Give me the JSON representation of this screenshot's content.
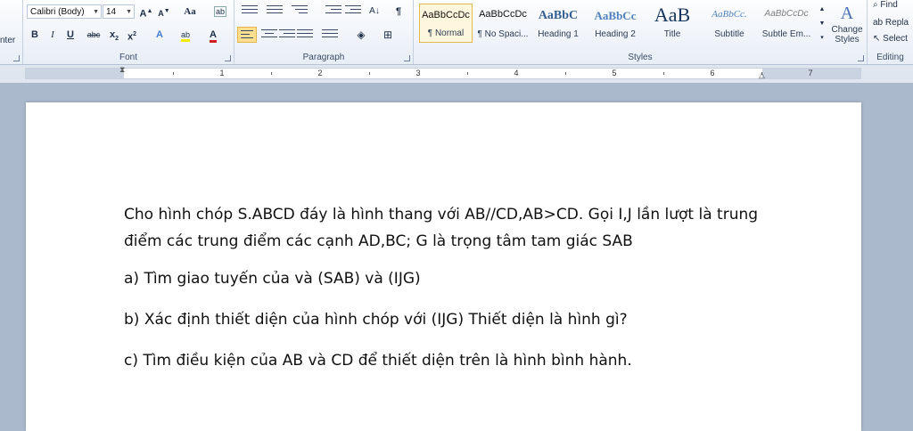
{
  "ribbon": {
    "clipboard_fragment": "nter",
    "font": {
      "group_label": "Font",
      "font_name": "Calibri (Body)",
      "font_size": "14",
      "grow_glyph": "A",
      "shrink_glyph": "A",
      "change_case": "Aa",
      "bold": "B",
      "italic": "I",
      "underline": "U",
      "strike": "abc",
      "subscript": "x",
      "superscript": "x",
      "font_color_glyph": "A",
      "text_effects_glyph": "A",
      "highlight_glyph": "ab"
    },
    "paragraph": {
      "group_label": "Paragraph",
      "pilcrow": "¶"
    },
    "styles": {
      "group_label": "Styles",
      "tiles": [
        {
          "sample": "AaBbCcDc",
          "name": "¶ Normal"
        },
        {
          "sample": "AaBbCcDc",
          "name": "¶ No Spaci..."
        },
        {
          "sample": "AaBbC",
          "name": "Heading 1"
        },
        {
          "sample": "AaBbCc",
          "name": "Heading 2"
        },
        {
          "sample": "AaB",
          "name": "Title"
        },
        {
          "sample": "AaBbCc.",
          "name": "Subtitle"
        },
        {
          "sample": "AaBbCcDc",
          "name": "Subtle Em..."
        }
      ],
      "change_styles_line1": "Change",
      "change_styles_line2": "Styles"
    },
    "editing": {
      "group_label": "Editing",
      "find": "Find",
      "replace": "Repla",
      "select": "Select"
    }
  },
  "ruler": {
    "numbers": [
      "1",
      "2",
      "3",
      "4",
      "5",
      "6",
      "7"
    ]
  },
  "document": {
    "paragraphs": [
      "Cho hình chóp S.ABCD đáy là hình thang với AB//CD,AB>CD.  Gọi I,J lần lượt là trung điểm các trung điểm các cạnh AD,BC; G là trọng tâm tam giác SAB",
      "a) Tìm giao tuyến của và  (SAB) và (IJG)",
      "b) Xác định thiết diện của hình chóp với (IJG) Thiết diện là hình gì?",
      "c) Tìm điều kiện của AB và CD để thiết diện trên là hình bình hành."
    ]
  },
  "colors": {
    "highlight": "#f6e900",
    "font_color": "#d02020",
    "heading_blue": "#3b5998"
  }
}
